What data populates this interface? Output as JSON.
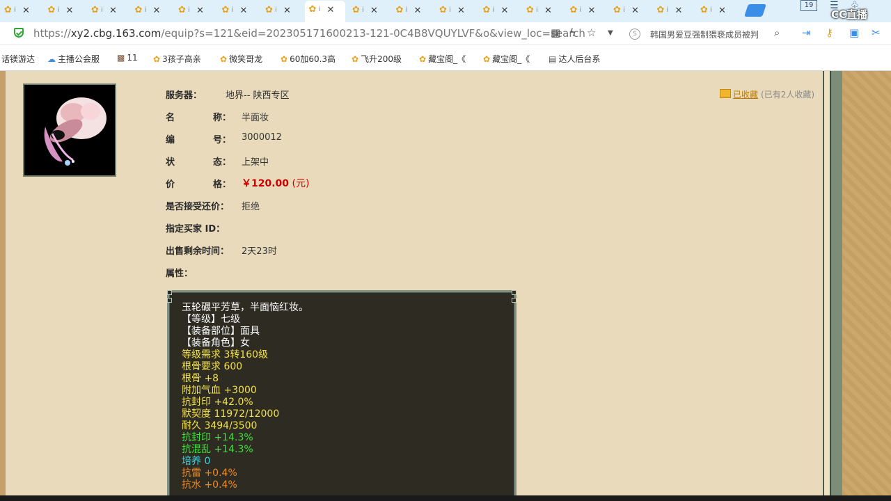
{
  "tabs": {
    "inactive_count": 18,
    "active_index": 7,
    "close_glyph": "✕",
    "info_glyph": "ⅰ"
  },
  "window": {
    "badge": "19",
    "overlay_logo": "CC直播"
  },
  "address_bar": {
    "url_prefix": "https://",
    "url_host": "xy2.cbg.163.com",
    "url_path": "/equip?s=121&eid=202305171600213-121-0C4B8VQUYLVF&o&view_loc=search",
    "search_suggestion": "韩国男爱豆强制猥亵成员被判"
  },
  "bookmarks": [
    "话镁游达",
    "主播公会服",
    "11",
    "3孩子高亲",
    "微笑哥龙",
    "60加60.3高",
    "飞升200级",
    "藏宝阁_《",
    "藏宝阁_《",
    "达人后台系"
  ],
  "item": {
    "server_label": "服务器：",
    "server_value": "地界-- 陕西专区",
    "name_label": [
      "名",
      "称："
    ],
    "name_value": "半面妆",
    "id_label": [
      "编",
      "号："
    ],
    "id_value": "3000012",
    "status_label": [
      "状",
      "态："
    ],
    "status_value": "上架中",
    "price_label": [
      "价",
      "格："
    ],
    "price_value": "￥120.00",
    "price_unit": "(元)",
    "bargain_label": "是否接受还价：",
    "bargain_value": "拒绝",
    "buyer_label": "指定买家 ID：",
    "time_label": "出售剩余时间：",
    "time_value": "2天23时",
    "attr_label": "属性："
  },
  "favorite": {
    "link": "已收藏",
    "count": "(已有2人收藏)"
  },
  "colors": {
    "page_bg": "#e8dabb",
    "price": "#cc0000",
    "attr_white": "#ffffff",
    "attr_yellow": "#f2e14a",
    "attr_green": "#3ee23e",
    "attr_cyan": "#35d5e0",
    "attr_orange": "#f08a22"
  },
  "attributes": [
    {
      "text": "玉轮碾平芳草，半面恼红妆。",
      "color": "#ffffff"
    },
    {
      "text": "【等级】七级",
      "color": "#ffffff"
    },
    {
      "text": "【装备部位】面具",
      "color": "#ffffff"
    },
    {
      "text": "【装备角色】女",
      "color": "#ffffff"
    },
    {
      "text": "等级需求 3转160级",
      "color": "#f2e14a"
    },
    {
      "text": "根骨要求 600",
      "color": "#f2e14a"
    },
    {
      "text": "根骨 +8",
      "color": "#f2e14a"
    },
    {
      "text": "附加气血 +3000",
      "color": "#f2e14a"
    },
    {
      "text": "抗封印 +42.0%",
      "color": "#f2e14a"
    },
    {
      "text": "默契度 11972/12000",
      "color": "#f2e14a"
    },
    {
      "text": "耐久 3494/3500",
      "color": "#f2e14a"
    },
    {
      "text": "抗封印 +14.3%",
      "color": "#3ee23e"
    },
    {
      "text": "抗混乱 +14.3%",
      "color": "#3ee23e"
    },
    {
      "text": "培养 0",
      "color": "#35d5e0"
    },
    {
      "text": "抗雷 +0.4%",
      "color": "#f08a22"
    },
    {
      "text": "抗水 +0.4%",
      "color": "#f08a22"
    }
  ]
}
